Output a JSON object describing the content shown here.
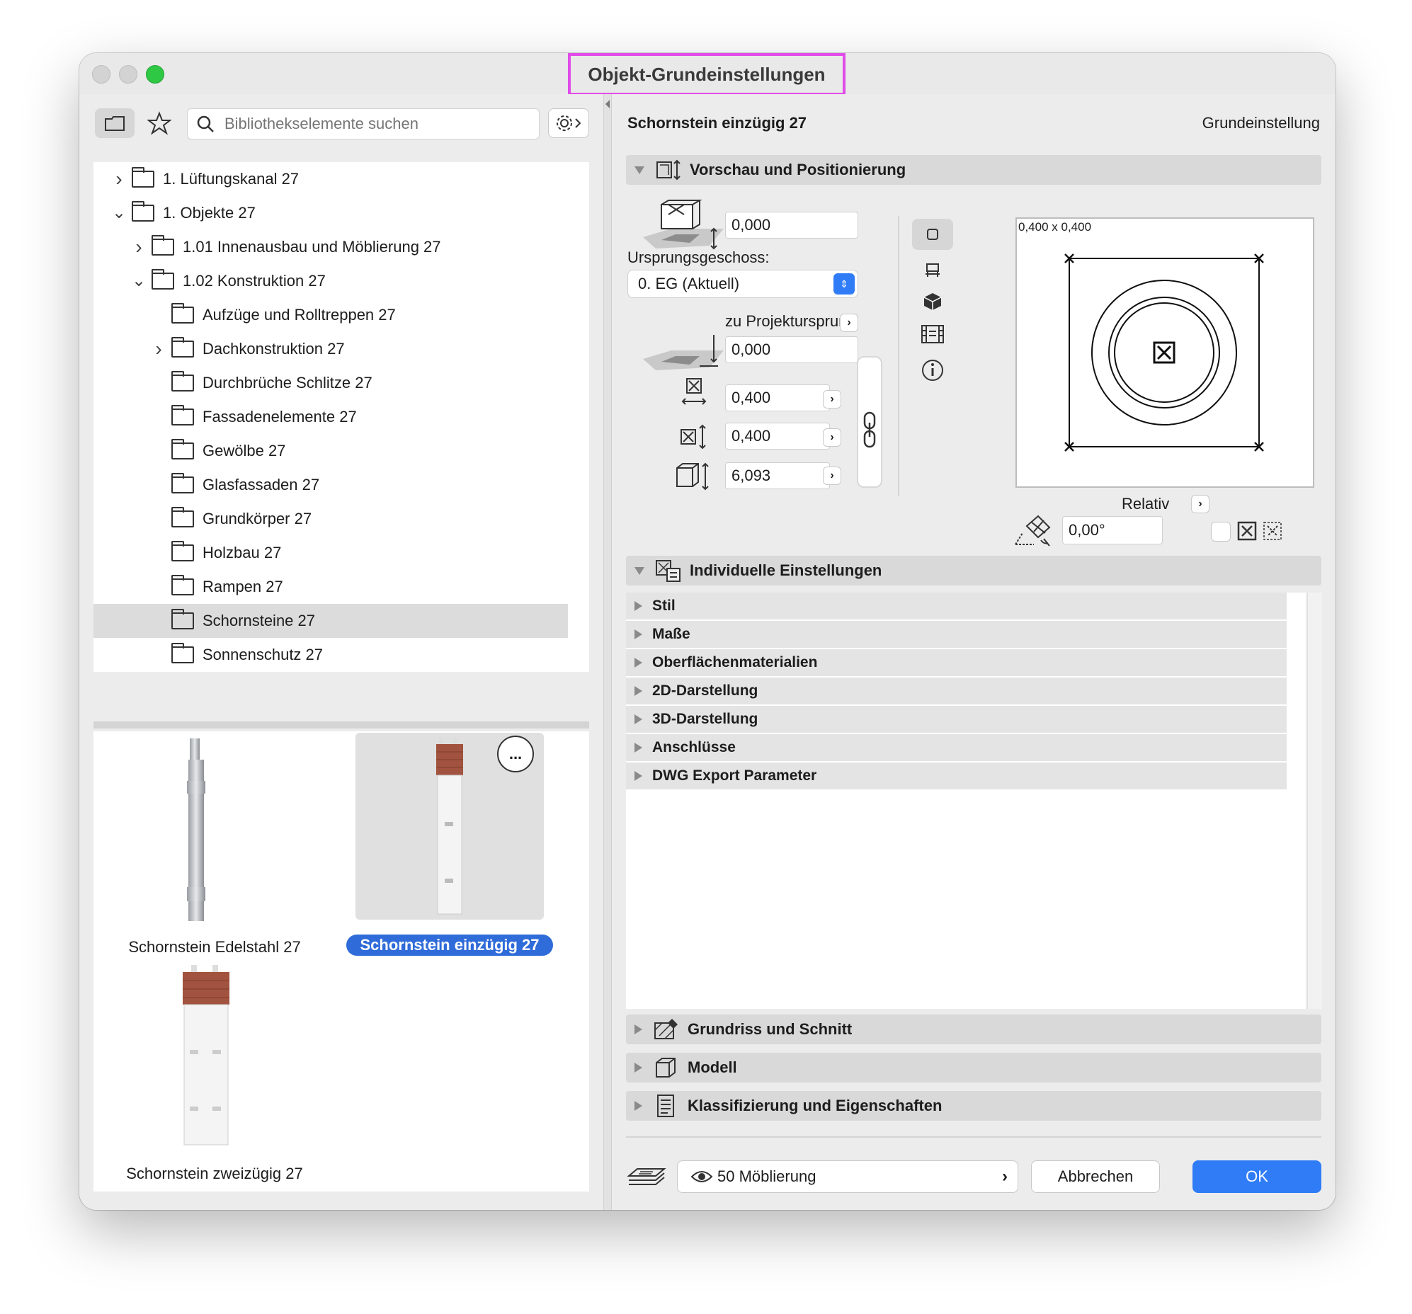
{
  "window": {
    "title": "Objekt-Grundeinstellungen"
  },
  "left": {
    "search_placeholder": "Bibliothekselemente suchen",
    "tree": [
      {
        "label": "1. Lüftungskanal 27",
        "indent": 0,
        "chevron": ">"
      },
      {
        "label": "1. Objekte 27",
        "indent": 0,
        "chevron": "v"
      },
      {
        "label": "1.01 Innenausbau und Möblierung 27",
        "indent": 1,
        "chevron": ">"
      },
      {
        "label": "1.02 Konstruktion 27",
        "indent": 1,
        "chevron": "v"
      },
      {
        "label": "Aufzüge und Rolltreppen 27",
        "indent": 2,
        "chevron": ""
      },
      {
        "label": "Dachkonstruktion 27",
        "indent": 2,
        "chevron": ">"
      },
      {
        "label": "Durchbrüche Schlitze 27",
        "indent": 2,
        "chevron": ""
      },
      {
        "label": "Fassadenelemente 27",
        "indent": 2,
        "chevron": ""
      },
      {
        "label": "Gewölbe 27",
        "indent": 2,
        "chevron": ""
      },
      {
        "label": "Glasfassaden 27",
        "indent": 2,
        "chevron": ""
      },
      {
        "label": "Grundkörper 27",
        "indent": 2,
        "chevron": ""
      },
      {
        "label": "Holzbau 27",
        "indent": 2,
        "chevron": ""
      },
      {
        "label": "Rampen 27",
        "indent": 2,
        "chevron": ""
      },
      {
        "label": "Schornsteine 27",
        "indent": 2,
        "chevron": "",
        "selected": true
      },
      {
        "label": "Sonnenschutz 27",
        "indent": 2,
        "chevron": ""
      }
    ],
    "gallery": [
      {
        "label": "Schornstein Edelstahl 27"
      },
      {
        "label": "Schornstein einzügig 27",
        "selected": true
      },
      {
        "label": "Schornstein zweizügig 27"
      }
    ],
    "more_label": "..."
  },
  "right": {
    "object_name": "Schornstein einzügig 27",
    "mode_label": "Grundeinstellung",
    "section_preview": "Vorschau und Positionierung",
    "elevation_value": "0,000",
    "home_story_label": "Ursprungsgeschoss:",
    "home_story_value": "0. EG (Aktuell)",
    "project_zero_label": "zu Projektursprung",
    "project_zero_value": "0,000",
    "width_value": "0,400",
    "depth_value": "0,400",
    "height_value": "6,093",
    "preview_dims": "0,400 x 0,400",
    "relative_label": "Relativ",
    "angle_value": "0,00°",
    "section_custom": "Individuelle Einstellungen",
    "subsections": [
      "Stil",
      "Maße",
      "Oberflächenmaterialien",
      "2D-Darstellung",
      "3D-Darstellung",
      "Anschlüsse",
      "DWG Export Parameter"
    ],
    "section_floorplan": "Grundriss und Schnitt",
    "section_model": "Modell",
    "section_class": "Klassifizierung und Eigenschaften",
    "layer_value": "50 Möblierung",
    "cancel_label": "Abbrechen",
    "ok_label": "OK"
  }
}
